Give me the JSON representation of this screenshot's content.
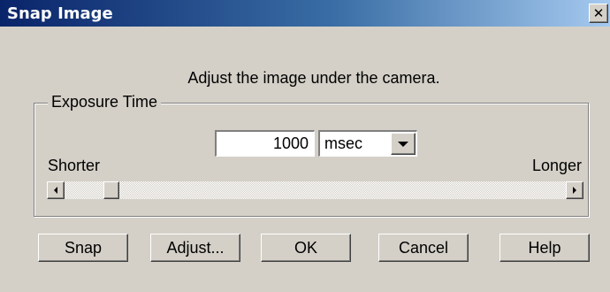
{
  "window": {
    "title": "Snap Image",
    "close_glyph": "✕",
    "close_icon": "close-icon"
  },
  "instruction": "Adjust the image under the camera.",
  "exposure": {
    "group_label": "Exposure Time",
    "value": "1000",
    "unit": "msec",
    "shorter_label": "Shorter",
    "longer_label": "Longer",
    "slider_position_fraction": 0.08
  },
  "buttons": {
    "snap": "Snap",
    "adjust": "Adjust...",
    "ok": "OK",
    "cancel": "Cancel",
    "help": "Help"
  },
  "colors": {
    "title_start": "#0a246a",
    "title_end": "#a6caf0",
    "face": "#d4d0c8"
  }
}
